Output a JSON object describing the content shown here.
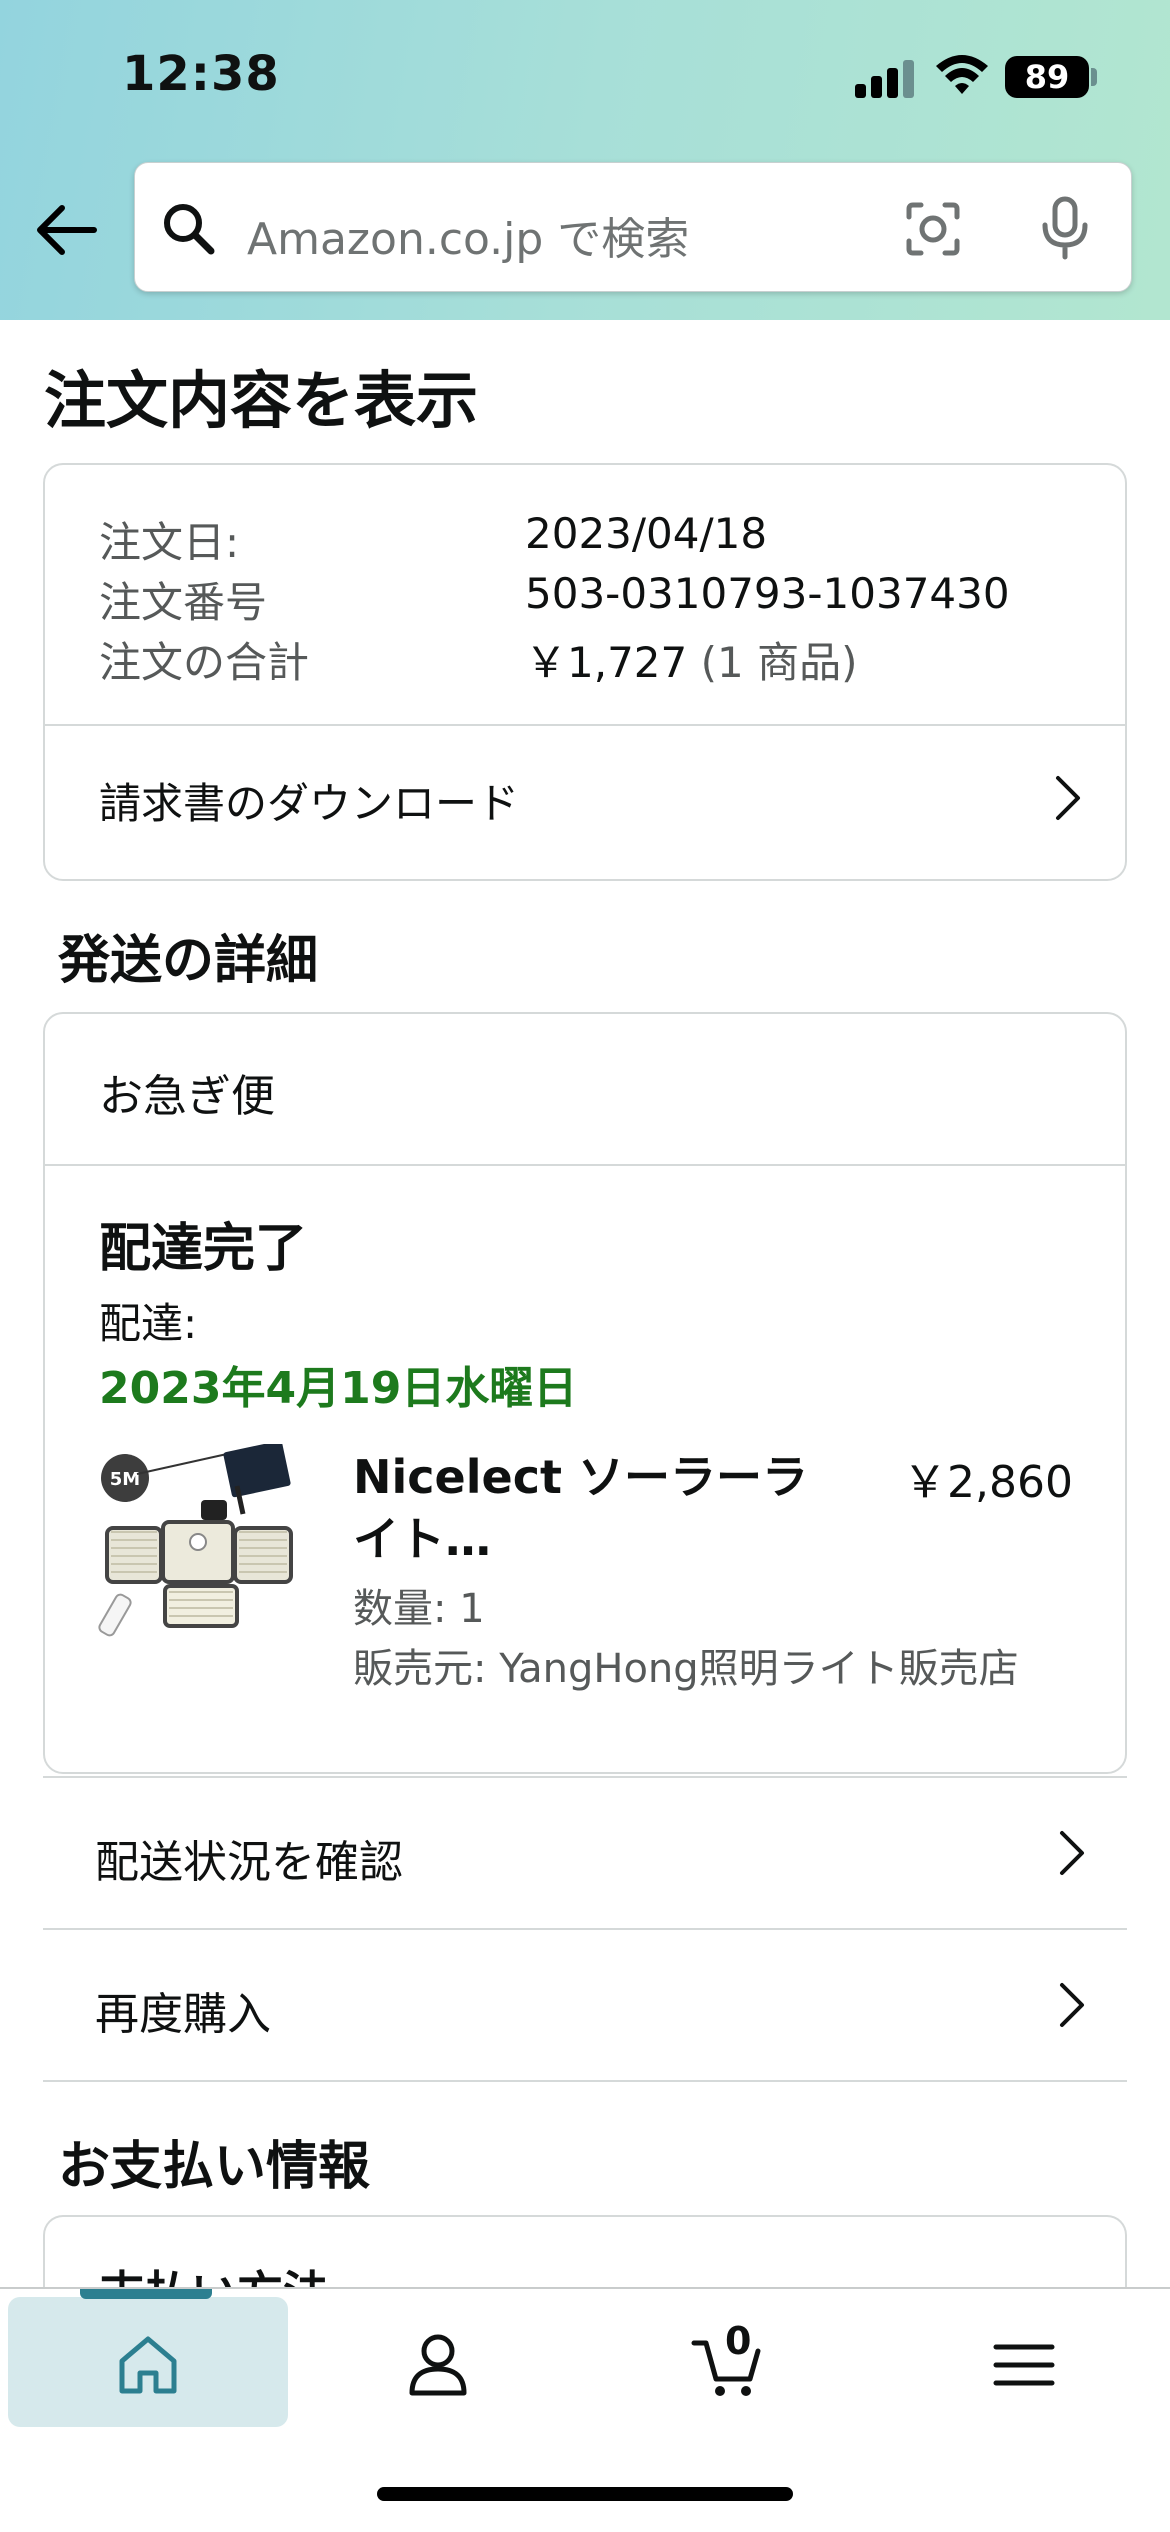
{
  "status_bar": {
    "time": "12:38",
    "battery": "89"
  },
  "search": {
    "placeholder": "Amazon.co.jp で検索"
  },
  "page": {
    "title": "注文内容を表示"
  },
  "order_summary": {
    "date_label": "注文日:",
    "date_value": "2023/04/18",
    "number_label": "注文番号",
    "number_value": "503-0310793-1037430",
    "total_label": "注文の合計",
    "total_value": "￥1,727",
    "total_items": "(1 商品)",
    "invoice_link": "請求書のダウンロード"
  },
  "shipping": {
    "section_title": "発送の詳細",
    "ship_type": "お急ぎ便",
    "status": "配達完了",
    "delivered_label": "配達:",
    "delivered_date": "2023年4月19日水曜日",
    "product": {
      "name": "Nicelect ソーラーライト…",
      "price": "￥2,860",
      "quantity": "数量: 1",
      "seller": "販売元: YangHong照明ライト販売店",
      "image_badge": "5M"
    },
    "track_link": "配送状況を確認",
    "rebuy_link": "再度購入"
  },
  "payment": {
    "section_title": "お支払い情報",
    "method_label": "支払い方法"
  },
  "bottom_nav": {
    "cart_count": "0"
  },
  "colors": {
    "header_start": "#93d4de",
    "header_end": "#b2e6d0",
    "delivered_green": "#1d7a1d",
    "nav_active": "#2c7f90"
  }
}
